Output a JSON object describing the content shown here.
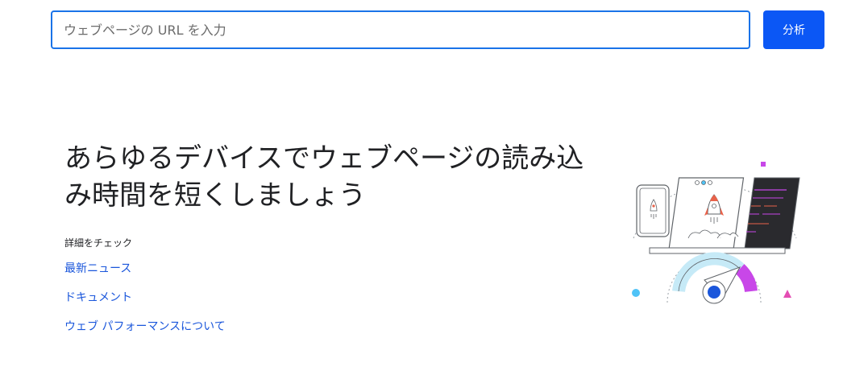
{
  "search": {
    "placeholder": "ウェブページの URL を入力",
    "button_label": "分析"
  },
  "hero": {
    "headline": "あらゆるデバイスでウェブページの読み込み時間を短くしましょう"
  },
  "learn_more": {
    "heading": "詳細をチェック",
    "links": [
      "最新ニュース",
      "ドキュメント",
      "ウェブ パフォーマンスについて"
    ]
  },
  "colors": {
    "accent": "#0b57f5",
    "link": "#1a56db",
    "input_border": "#1a73e8",
    "gauge_purple": "#c847e8",
    "gauge_light_blue": "#c6eaf7",
    "gauge_knob": "#1a56db"
  }
}
